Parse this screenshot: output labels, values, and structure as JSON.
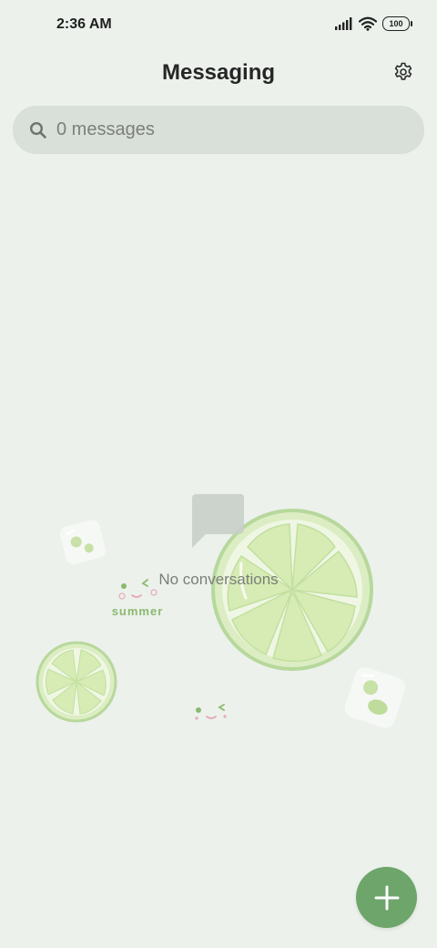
{
  "status_bar": {
    "time": "2:36 AM",
    "battery": "100",
    "icons": [
      "signal-icon",
      "wifi-icon",
      "battery-icon"
    ]
  },
  "header": {
    "title": "Messaging",
    "settings_icon": "gear-icon"
  },
  "search": {
    "placeholder": "0 messages",
    "icon": "search-icon"
  },
  "empty_state": {
    "label": "No conversations",
    "decoration_text": "summer"
  },
  "fab": {
    "icon": "plus-icon"
  },
  "colors": {
    "background": "#ECF1EC",
    "search_bg": "#D9DFD9",
    "accent": "#6DA56A",
    "lime_light": "#DFF0C4",
    "lime_rind": "#B7D89C"
  }
}
